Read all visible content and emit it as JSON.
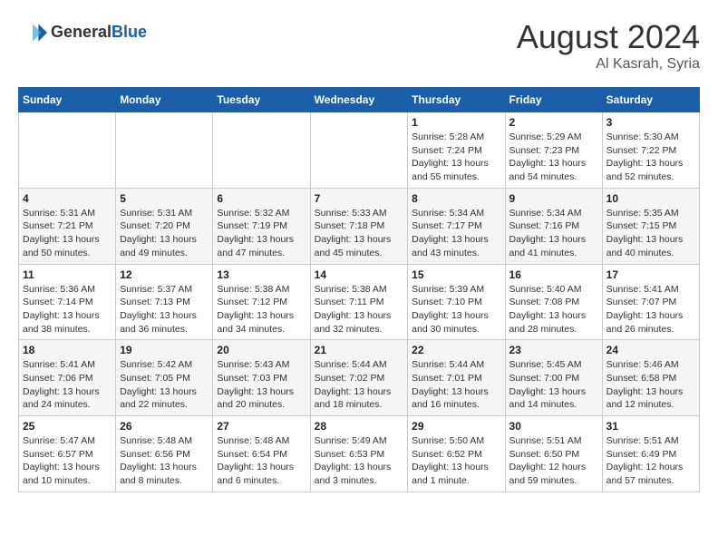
{
  "header": {
    "logo_general": "General",
    "logo_blue": "Blue",
    "month_year": "August 2024",
    "location": "Al Kasrah, Syria"
  },
  "days_of_week": [
    "Sunday",
    "Monday",
    "Tuesday",
    "Wednesday",
    "Thursday",
    "Friday",
    "Saturday"
  ],
  "weeks": [
    [
      {
        "day": "",
        "info": ""
      },
      {
        "day": "",
        "info": ""
      },
      {
        "day": "",
        "info": ""
      },
      {
        "day": "",
        "info": ""
      },
      {
        "day": "1",
        "info": "Sunrise: 5:28 AM\nSunset: 7:24 PM\nDaylight: 13 hours\nand 55 minutes."
      },
      {
        "day": "2",
        "info": "Sunrise: 5:29 AM\nSunset: 7:23 PM\nDaylight: 13 hours\nand 54 minutes."
      },
      {
        "day": "3",
        "info": "Sunrise: 5:30 AM\nSunset: 7:22 PM\nDaylight: 13 hours\nand 52 minutes."
      }
    ],
    [
      {
        "day": "4",
        "info": "Sunrise: 5:31 AM\nSunset: 7:21 PM\nDaylight: 13 hours\nand 50 minutes."
      },
      {
        "day": "5",
        "info": "Sunrise: 5:31 AM\nSunset: 7:20 PM\nDaylight: 13 hours\nand 49 minutes."
      },
      {
        "day": "6",
        "info": "Sunrise: 5:32 AM\nSunset: 7:19 PM\nDaylight: 13 hours\nand 47 minutes."
      },
      {
        "day": "7",
        "info": "Sunrise: 5:33 AM\nSunset: 7:18 PM\nDaylight: 13 hours\nand 45 minutes."
      },
      {
        "day": "8",
        "info": "Sunrise: 5:34 AM\nSunset: 7:17 PM\nDaylight: 13 hours\nand 43 minutes."
      },
      {
        "day": "9",
        "info": "Sunrise: 5:34 AM\nSunset: 7:16 PM\nDaylight: 13 hours\nand 41 minutes."
      },
      {
        "day": "10",
        "info": "Sunrise: 5:35 AM\nSunset: 7:15 PM\nDaylight: 13 hours\nand 40 minutes."
      }
    ],
    [
      {
        "day": "11",
        "info": "Sunrise: 5:36 AM\nSunset: 7:14 PM\nDaylight: 13 hours\nand 38 minutes."
      },
      {
        "day": "12",
        "info": "Sunrise: 5:37 AM\nSunset: 7:13 PM\nDaylight: 13 hours\nand 36 minutes."
      },
      {
        "day": "13",
        "info": "Sunrise: 5:38 AM\nSunset: 7:12 PM\nDaylight: 13 hours\nand 34 minutes."
      },
      {
        "day": "14",
        "info": "Sunrise: 5:38 AM\nSunset: 7:11 PM\nDaylight: 13 hours\nand 32 minutes."
      },
      {
        "day": "15",
        "info": "Sunrise: 5:39 AM\nSunset: 7:10 PM\nDaylight: 13 hours\nand 30 minutes."
      },
      {
        "day": "16",
        "info": "Sunrise: 5:40 AM\nSunset: 7:08 PM\nDaylight: 13 hours\nand 28 minutes."
      },
      {
        "day": "17",
        "info": "Sunrise: 5:41 AM\nSunset: 7:07 PM\nDaylight: 13 hours\nand 26 minutes."
      }
    ],
    [
      {
        "day": "18",
        "info": "Sunrise: 5:41 AM\nSunset: 7:06 PM\nDaylight: 13 hours\nand 24 minutes."
      },
      {
        "day": "19",
        "info": "Sunrise: 5:42 AM\nSunset: 7:05 PM\nDaylight: 13 hours\nand 22 minutes."
      },
      {
        "day": "20",
        "info": "Sunrise: 5:43 AM\nSunset: 7:03 PM\nDaylight: 13 hours\nand 20 minutes."
      },
      {
        "day": "21",
        "info": "Sunrise: 5:44 AM\nSunset: 7:02 PM\nDaylight: 13 hours\nand 18 minutes."
      },
      {
        "day": "22",
        "info": "Sunrise: 5:44 AM\nSunset: 7:01 PM\nDaylight: 13 hours\nand 16 minutes."
      },
      {
        "day": "23",
        "info": "Sunrise: 5:45 AM\nSunset: 7:00 PM\nDaylight: 13 hours\nand 14 minutes."
      },
      {
        "day": "24",
        "info": "Sunrise: 5:46 AM\nSunset: 6:58 PM\nDaylight: 13 hours\nand 12 minutes."
      }
    ],
    [
      {
        "day": "25",
        "info": "Sunrise: 5:47 AM\nSunset: 6:57 PM\nDaylight: 13 hours\nand 10 minutes."
      },
      {
        "day": "26",
        "info": "Sunrise: 5:48 AM\nSunset: 6:56 PM\nDaylight: 13 hours\nand 8 minutes."
      },
      {
        "day": "27",
        "info": "Sunrise: 5:48 AM\nSunset: 6:54 PM\nDaylight: 13 hours\nand 6 minutes."
      },
      {
        "day": "28",
        "info": "Sunrise: 5:49 AM\nSunset: 6:53 PM\nDaylight: 13 hours\nand 3 minutes."
      },
      {
        "day": "29",
        "info": "Sunrise: 5:50 AM\nSunset: 6:52 PM\nDaylight: 13 hours\nand 1 minute."
      },
      {
        "day": "30",
        "info": "Sunrise: 5:51 AM\nSunset: 6:50 PM\nDaylight: 12 hours\nand 59 minutes."
      },
      {
        "day": "31",
        "info": "Sunrise: 5:51 AM\nSunset: 6:49 PM\nDaylight: 12 hours\nand 57 minutes."
      }
    ]
  ]
}
